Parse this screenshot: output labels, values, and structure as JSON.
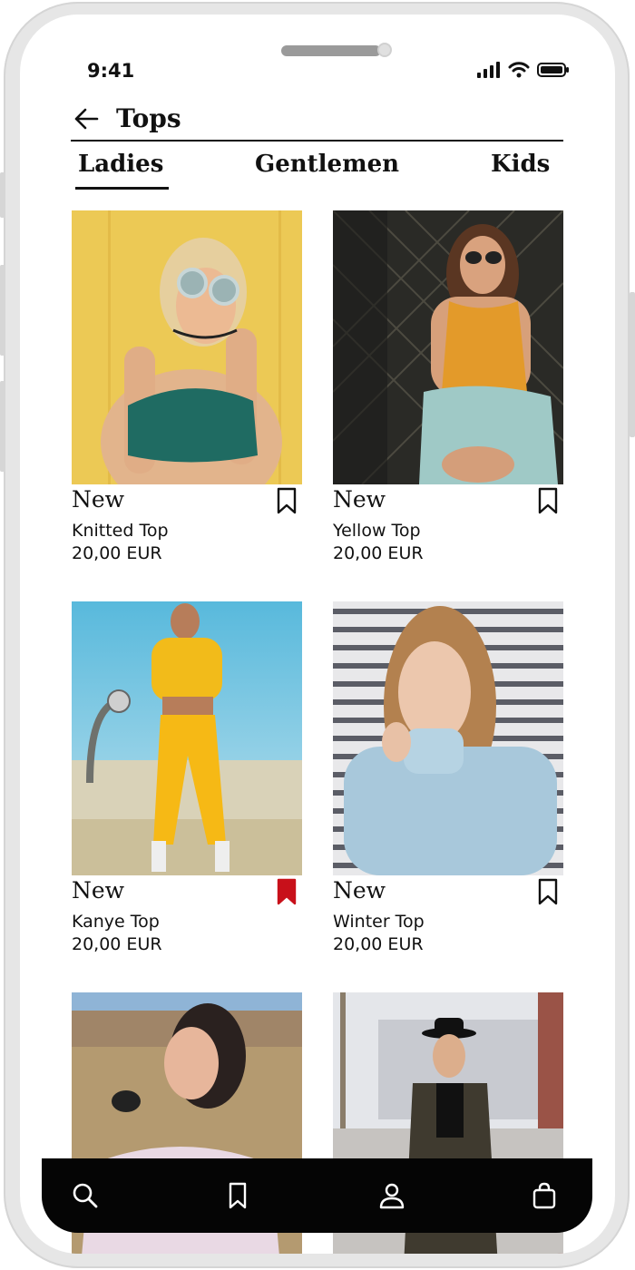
{
  "status_bar": {
    "time": "9:41"
  },
  "header": {
    "title": "Tops",
    "back_icon": "arrow-left-icon"
  },
  "tabs": [
    {
      "label": "Ladies",
      "active": true
    },
    {
      "label": "Gentlemen",
      "active": false
    },
    {
      "label": "Kids",
      "active": false
    }
  ],
  "products": [
    {
      "badge": "New",
      "name": "Knitted Top",
      "price": "20,00 EUR",
      "bookmarked": false
    },
    {
      "badge": "New",
      "name": "Yellow Top",
      "price": "20,00 EUR",
      "bookmarked": false
    },
    {
      "badge": "New",
      "name": "Kanye Top",
      "price": "20,00 EUR",
      "bookmarked": true
    },
    {
      "badge": "New",
      "name": "Winter Top",
      "price": "20,00 EUR",
      "bookmarked": false
    },
    {
      "badge": "",
      "name": "",
      "price": "",
      "bookmarked": false
    },
    {
      "badge": "",
      "name": "",
      "price": "",
      "bookmarked": false
    }
  ],
  "bottom_nav": {
    "icons": [
      "search-icon",
      "bookmark-icon",
      "user-icon",
      "shopping-bag-icon"
    ]
  },
  "colors": {
    "accent_bookmark": "#c8101a",
    "text": "#111111",
    "tabbar": "#050505"
  }
}
